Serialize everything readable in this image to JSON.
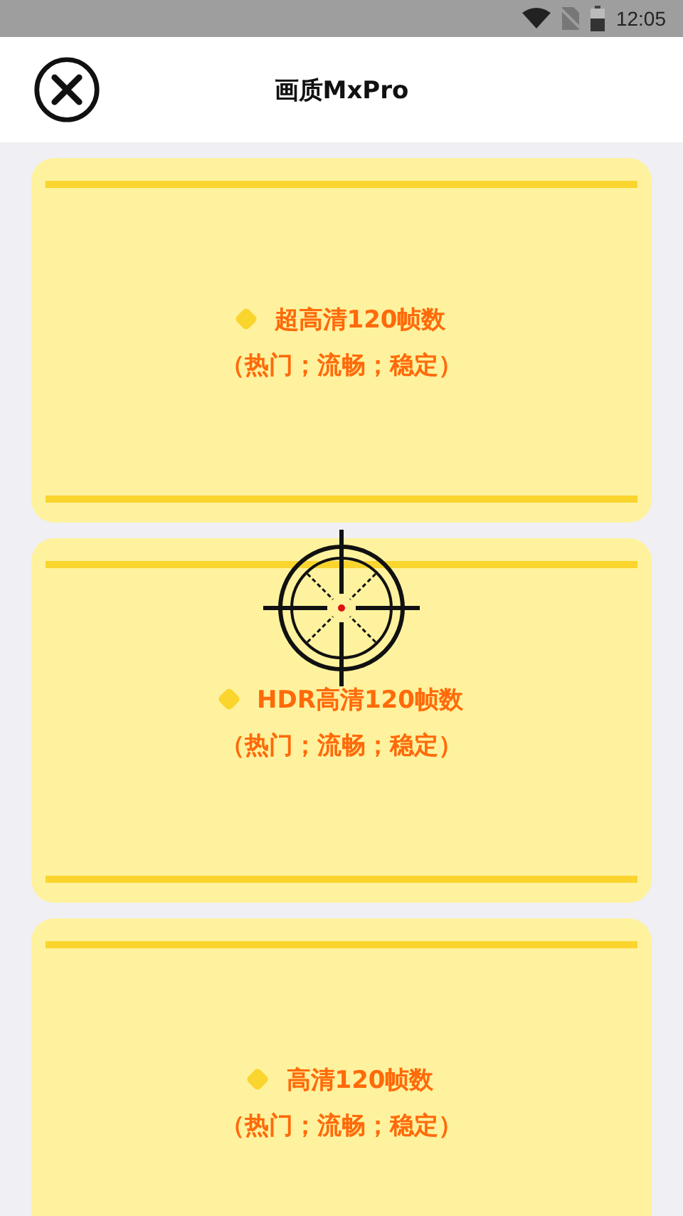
{
  "status_bar": {
    "time": "12:05"
  },
  "header": {
    "title": "画质MxPro"
  },
  "options": [
    {
      "title": "超高清120帧数",
      "subtitle": "（热门；流畅；稳定）"
    },
    {
      "title": "HDR高清120帧数",
      "subtitle": "（热门；流畅；稳定）"
    },
    {
      "title": "高清120帧数",
      "subtitle": "（热门；流畅；稳定）"
    }
  ]
}
